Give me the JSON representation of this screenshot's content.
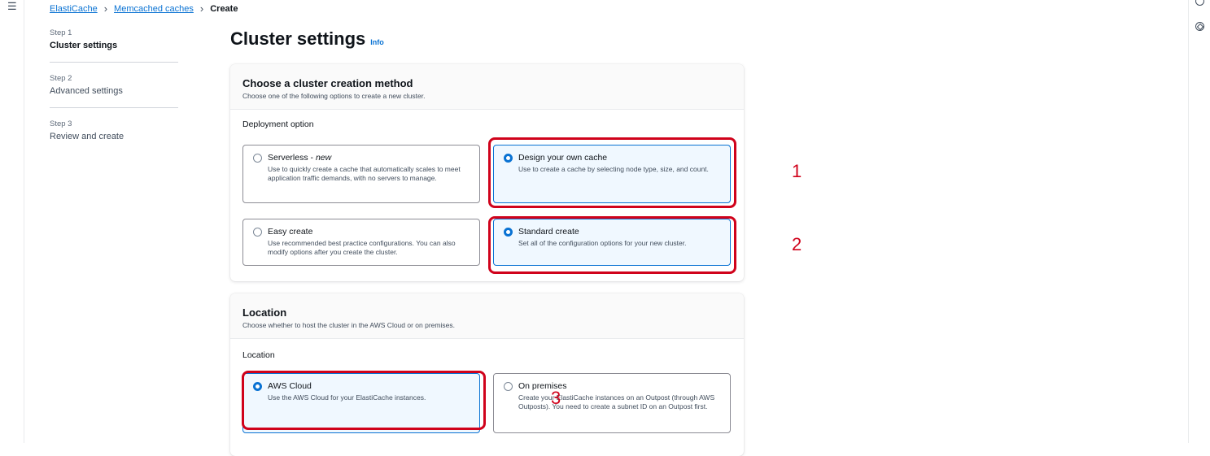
{
  "breadcrumb": {
    "items": [
      "ElastiCache",
      "Memcached caches"
    ],
    "current": "Create"
  },
  "steps": [
    {
      "num": "Step 1",
      "title": "Cluster settings"
    },
    {
      "num": "Step 2",
      "title": "Advanced settings"
    },
    {
      "num": "Step 3",
      "title": "Review and create"
    }
  ],
  "page": {
    "title": "Cluster settings",
    "info": "Info"
  },
  "creation": {
    "heading": "Choose a cluster creation method",
    "desc": "Choose one of the following options to create a new cluster.",
    "deployment_label": "Deployment option",
    "serverless_title": "Serverless - ",
    "serverless_new": "new",
    "serverless_desc": "Use to quickly create a cache that automatically scales to meet application traffic demands, with no servers to manage.",
    "design_title": "Design your own cache",
    "design_desc": "Use to create a cache by selecting node type, size, and count.",
    "easy_title": "Easy create",
    "easy_desc": "Use recommended best practice configurations. You can also modify options after you create the cluster.",
    "standard_title": "Standard create",
    "standard_desc": "Set all of the configuration options for your new cluster."
  },
  "location": {
    "heading": "Location",
    "desc": "Choose whether to host the cluster in the AWS Cloud or on premises.",
    "label": "Location",
    "aws_title": "AWS Cloud",
    "aws_desc": "Use the AWS Cloud for your ElastiCache instances.",
    "onprem_title": "On premises",
    "onprem_desc": "Create your ElastiCache instances on an Outpost (through AWS Outposts). You need to create a subnet ID on an Outpost first."
  },
  "annotations": [
    "1",
    "2",
    "3"
  ],
  "colors": {
    "accent": "#0972d3",
    "annotation": "#d0021b"
  }
}
